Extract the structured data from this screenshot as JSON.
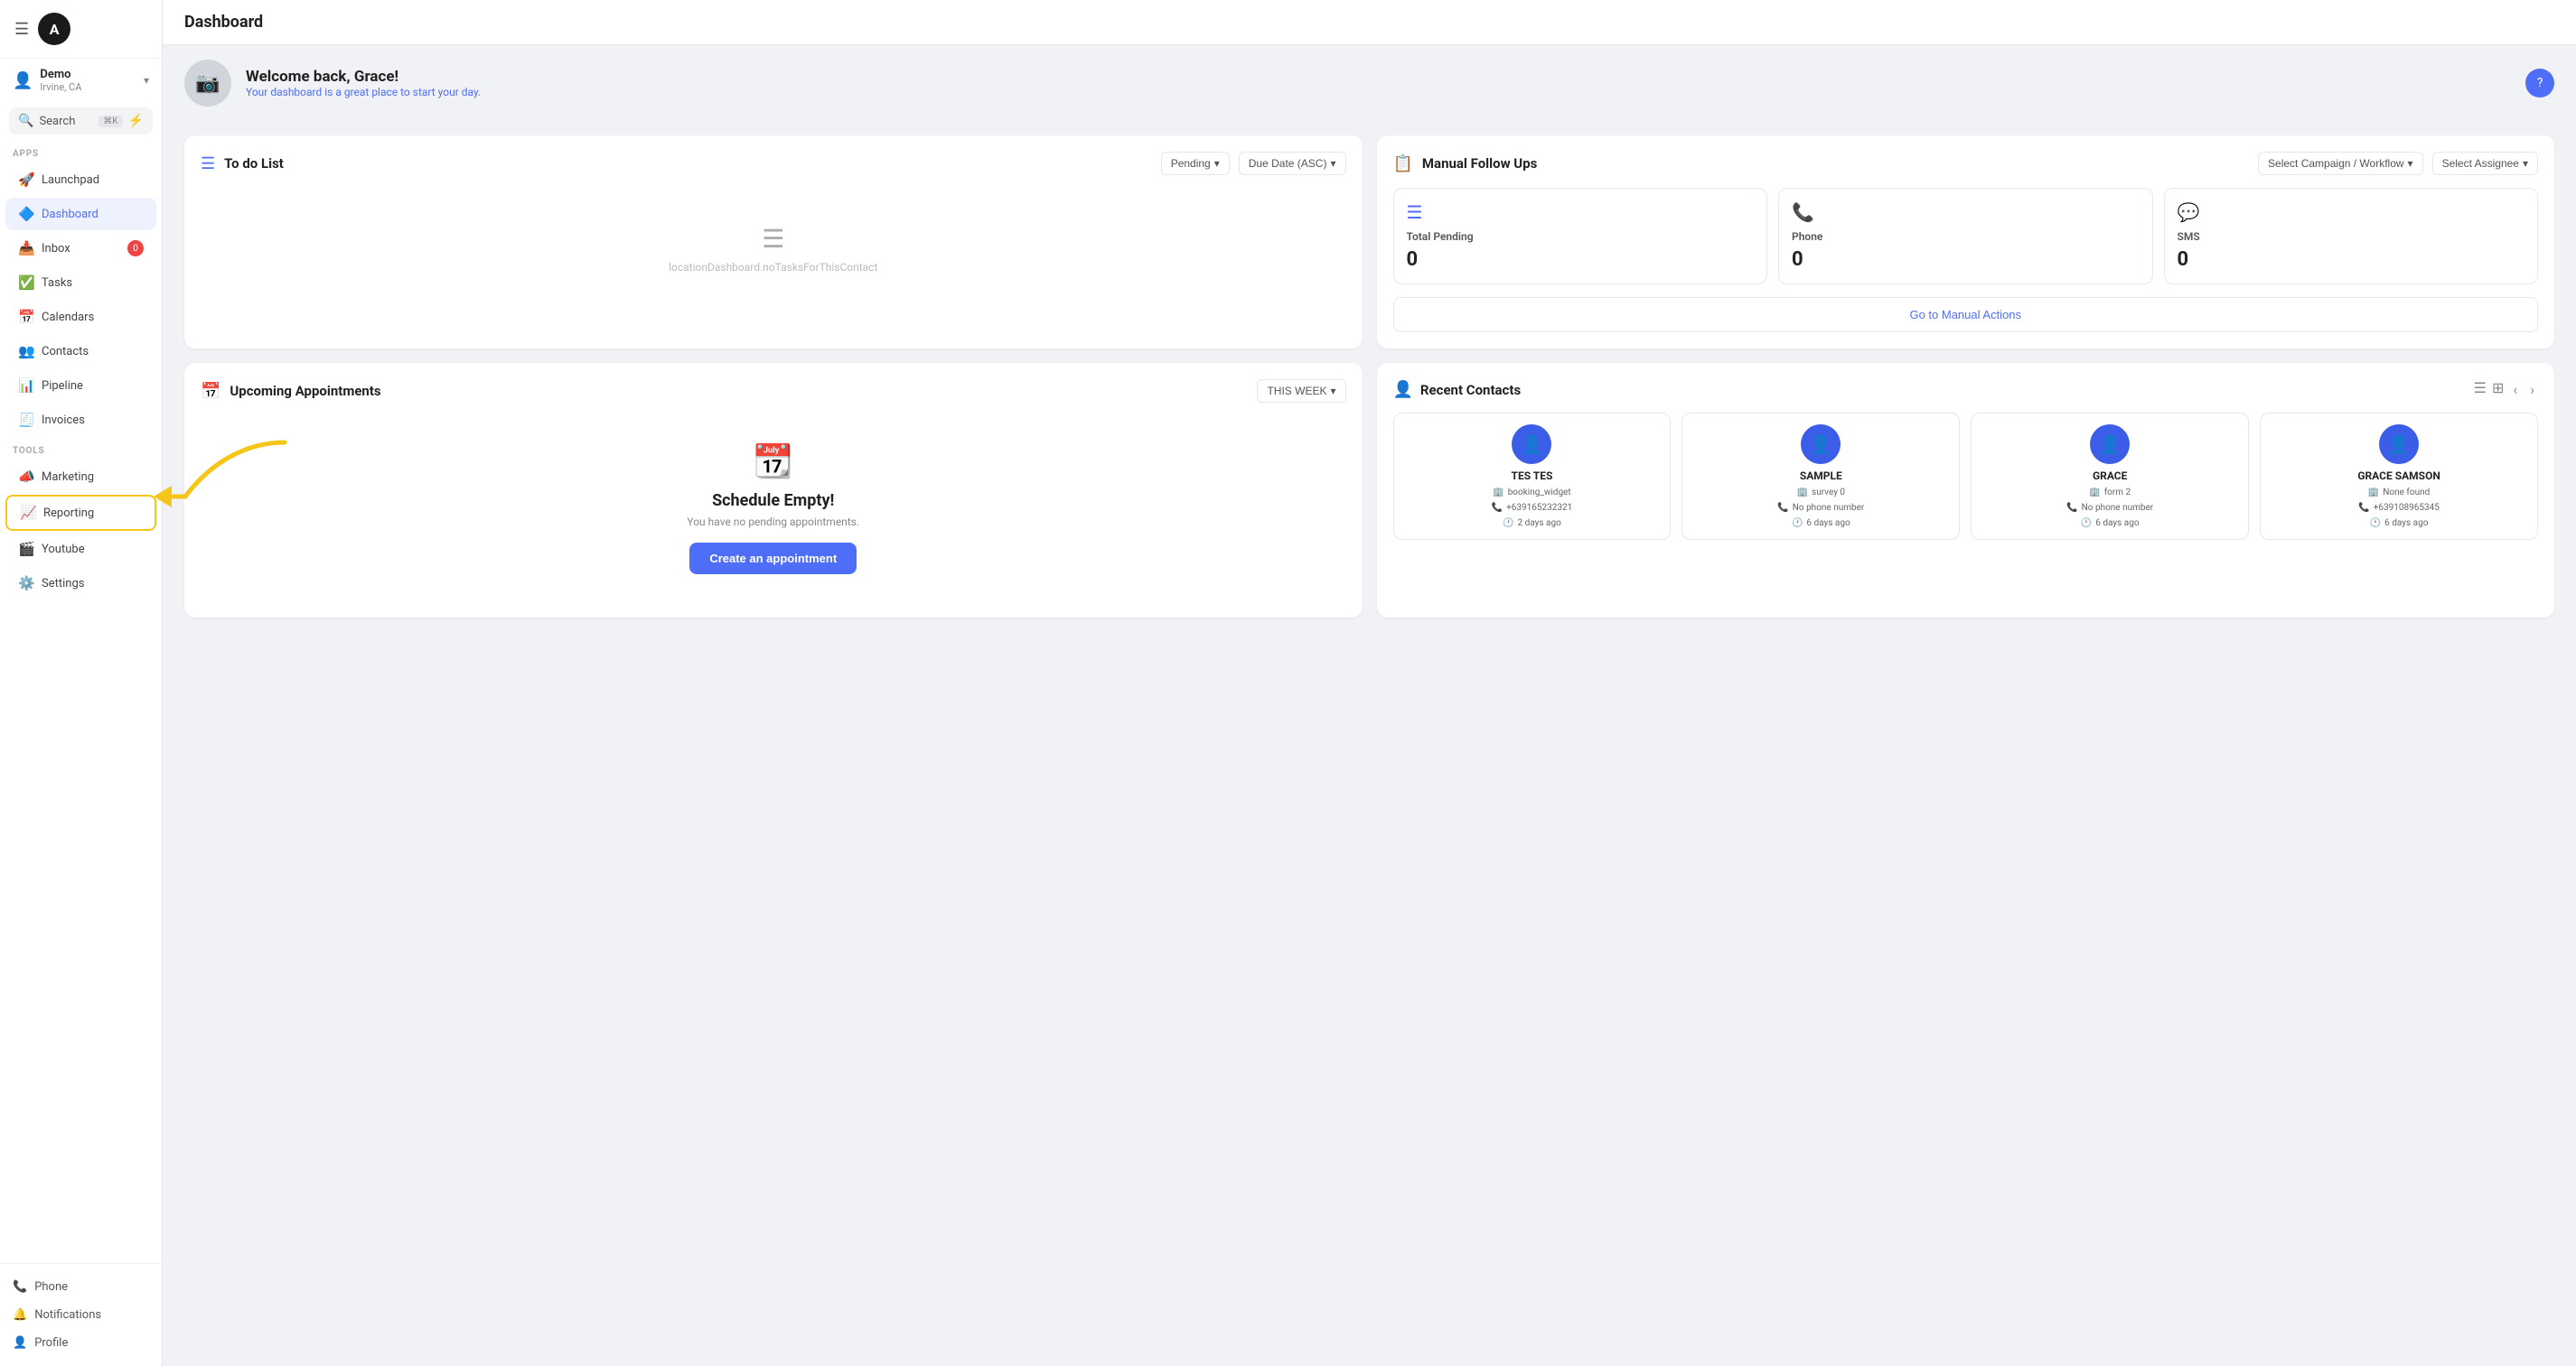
{
  "app": {
    "logo_letter": "A",
    "title": "Dashboard"
  },
  "account": {
    "name": "Demo",
    "location": "Irvine, CA"
  },
  "search": {
    "label": "Search",
    "kbd": "⌘K"
  },
  "sidebar": {
    "apps_label": "Apps",
    "tools_label": "Tools",
    "items_apps": [
      {
        "id": "launchpad",
        "label": "Launchpad",
        "icon": "🚀"
      },
      {
        "id": "dashboard",
        "label": "Dashboard",
        "icon": "🔷",
        "active": true
      },
      {
        "id": "inbox",
        "label": "Inbox",
        "icon": "📥",
        "badge": "0"
      },
      {
        "id": "tasks",
        "label": "Tasks",
        "icon": "✅"
      },
      {
        "id": "calendars",
        "label": "Calendars",
        "icon": "📅"
      },
      {
        "id": "contacts",
        "label": "Contacts",
        "icon": "👥"
      },
      {
        "id": "pipeline",
        "label": "Pipeline",
        "icon": "📊"
      },
      {
        "id": "invoices",
        "label": "Invoices",
        "icon": "🧾"
      }
    ],
    "items_tools": [
      {
        "id": "marketing",
        "label": "Marketing",
        "icon": "📣"
      },
      {
        "id": "reporting",
        "label": "Reporting",
        "icon": "📈",
        "highlighted": true
      },
      {
        "id": "youtube",
        "label": "Youtube",
        "icon": "🎬"
      },
      {
        "id": "settings",
        "label": "Settings",
        "icon": "⚙️"
      }
    ],
    "bottom": [
      {
        "id": "phone",
        "label": "Phone",
        "icon": "📞"
      },
      {
        "id": "notifications",
        "label": "Notifications",
        "icon": "🔔"
      },
      {
        "id": "profile",
        "label": "Profile",
        "icon": "👤"
      }
    ]
  },
  "welcome": {
    "greeting": "Welcome back, Grace!",
    "subtitle": "Your dashboard is a great place to start your day."
  },
  "todo": {
    "title": "To do List",
    "filter_status": "Pending",
    "filter_date": "Due Date (ASC)",
    "empty_text": "locationDashboard.noTasksForThisContact"
  },
  "manual_followups": {
    "title": "Manual Follow Ups",
    "select_campaign": "Select Campaign / Workflow",
    "select_assignee": "Select Assignee",
    "stats": [
      {
        "id": "total-pending",
        "label": "Total Pending",
        "value": "0",
        "icon": "☰"
      },
      {
        "id": "phone",
        "label": "Phone",
        "value": "0",
        "icon": "📞"
      },
      {
        "id": "sms",
        "label": "SMS",
        "value": "0",
        "icon": "💬"
      }
    ],
    "go_to_manual_btn": "Go to Manual Actions"
  },
  "appointments": {
    "title": "Upcoming Appointments",
    "filter": "THIS WEEK",
    "empty_title": "Schedule Empty!",
    "empty_sub": "You have no pending appointments.",
    "create_btn": "Create an appointment"
  },
  "recent_contacts": {
    "title": "Recent Contacts",
    "contacts": [
      {
        "id": "tes-tes",
        "name": "TES TES",
        "source": "booking_widget",
        "phone": "+639165232321",
        "time": "2 days ago"
      },
      {
        "id": "sample",
        "name": "SAMPLE",
        "source": "survey 0",
        "phone": "No phone number",
        "time": "6 days ago"
      },
      {
        "id": "grace",
        "name": "GRACE",
        "source": "form 2",
        "phone": "No phone number",
        "time": "6 days ago"
      },
      {
        "id": "grace-samson",
        "name": "GRACE SAMSON",
        "source": "None found",
        "phone": "+639108965345",
        "time": "6 days ago"
      }
    ]
  }
}
